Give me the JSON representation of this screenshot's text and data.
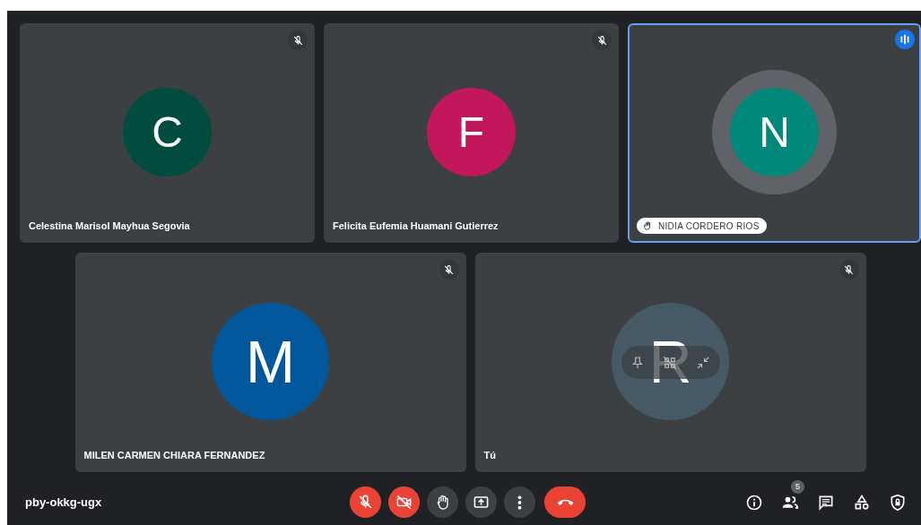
{
  "tiles": [
    {
      "name": "Celestina Marisol Mayhua Segovia",
      "initial": "C",
      "color": "#004d40",
      "muted": true,
      "speaking": false,
      "hand_raised": false,
      "hover_controls": false
    },
    {
      "name": "Felicita Eufemia Huamani Gutierrez",
      "initial": "F",
      "color": "#c2185b",
      "muted": true,
      "speaking": false,
      "hand_raised": false,
      "hover_controls": false
    },
    {
      "name": "NIDIA CORDERO RIOS",
      "initial": "N",
      "color": "#00897b",
      "muted": false,
      "speaking": true,
      "hand_raised": true,
      "hover_controls": false
    },
    {
      "name": "MILEN CARMEN CHIARA FERNANDEZ",
      "initial": "M",
      "color": "#01579b",
      "muted": true,
      "speaking": false,
      "hand_raised": false,
      "hover_controls": false
    },
    {
      "name": "Tú",
      "initial": "R",
      "color": "#455a64",
      "muted": true,
      "speaking": false,
      "hand_raised": false,
      "hover_controls": true
    }
  ],
  "meeting_code": "pby-okkg-ugx",
  "controls": [
    {
      "kind": "mic",
      "off": true
    },
    {
      "kind": "camera",
      "off": true
    },
    {
      "kind": "hand",
      "off": false
    },
    {
      "kind": "present",
      "off": false
    },
    {
      "kind": "more",
      "off": false
    },
    {
      "kind": "end"
    }
  ],
  "side_buttons": [
    {
      "kind": "info"
    },
    {
      "kind": "people",
      "badge": "5"
    },
    {
      "kind": "chat"
    },
    {
      "kind": "activities"
    },
    {
      "kind": "lock"
    }
  ]
}
